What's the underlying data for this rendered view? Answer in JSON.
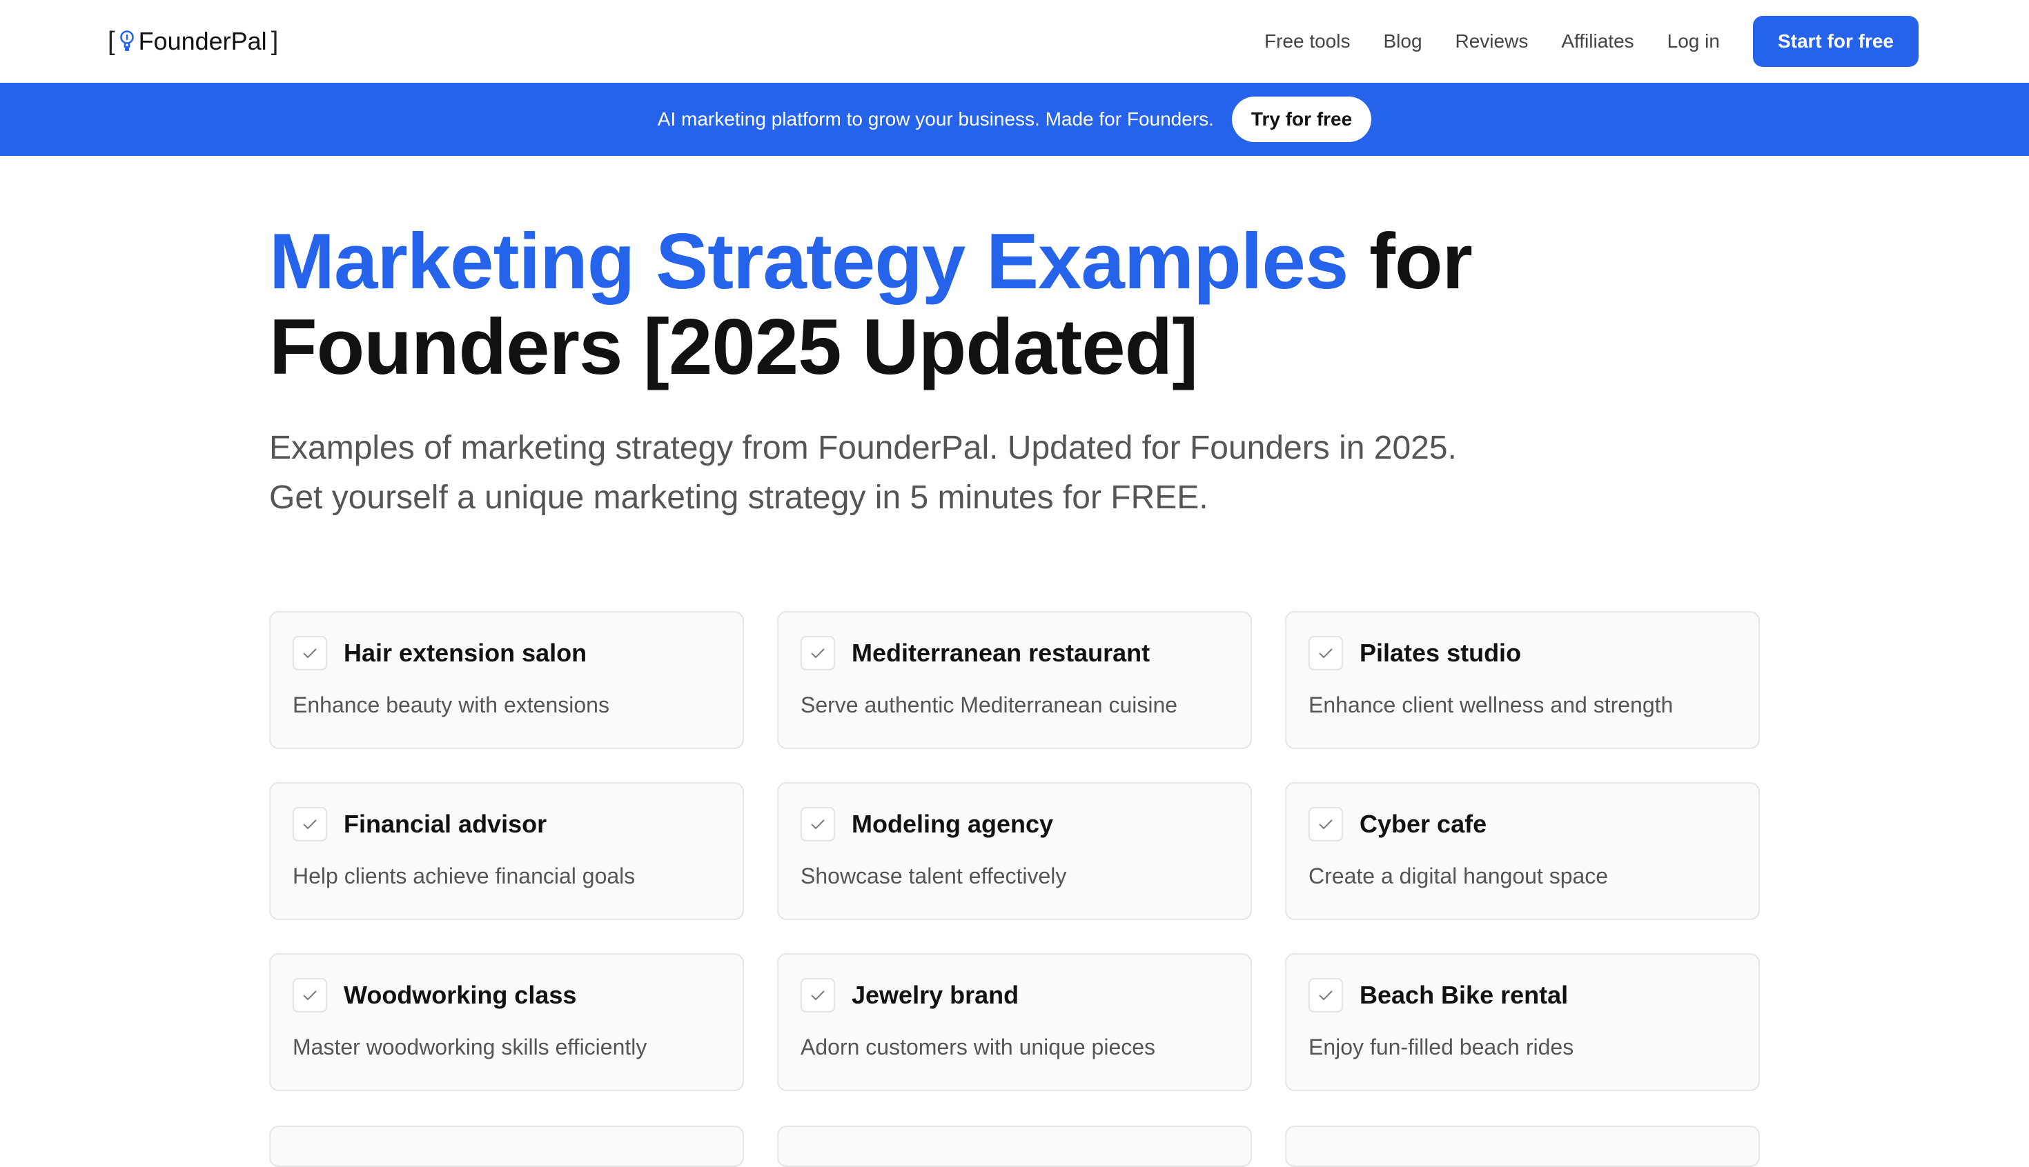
{
  "header": {
    "logo_left_bracket": "[",
    "logo_name": "FounderPal",
    "logo_right_bracket": "]",
    "nav": [
      {
        "label": "Free tools"
      },
      {
        "label": "Blog"
      },
      {
        "label": "Reviews"
      },
      {
        "label": "Affiliates"
      },
      {
        "label": "Log in"
      }
    ],
    "cta_label": "Start for free"
  },
  "banner": {
    "text": "AI marketing platform to grow your business. Made for Founders.",
    "button_label": "Try for free"
  },
  "hero": {
    "title_highlight": "Marketing Strategy Examples",
    "title_rest": " for Founders [2025 Updated]",
    "subtitle_line1": "Examples of marketing strategy from FounderPal. Updated for Founders in 2025.",
    "subtitle_line2": "Get yourself a unique marketing strategy in 5 minutes for FREE."
  },
  "cards": [
    {
      "title": "Hair extension salon",
      "description": "Enhance beauty with extensions"
    },
    {
      "title": "Mediterranean restaurant",
      "description": "Serve authentic Mediterranean cuisine"
    },
    {
      "title": "Pilates studio",
      "description": "Enhance client wellness and strength"
    },
    {
      "title": "Financial advisor",
      "description": "Help clients achieve financial goals"
    },
    {
      "title": "Modeling agency",
      "description": "Showcase talent effectively"
    },
    {
      "title": "Cyber cafe",
      "description": "Create a digital hangout space"
    },
    {
      "title": "Woodworking class",
      "description": "Master woodworking skills efficiently"
    },
    {
      "title": "Jewelry brand",
      "description": "Adorn customers with unique pieces"
    },
    {
      "title": "Beach Bike rental",
      "description": "Enjoy fun-filled beach rides"
    }
  ],
  "colors": {
    "accent": "#2563eb",
    "text": "#111111",
    "muted": "#555555",
    "card_bg": "#fafafa",
    "card_border": "#e5e5e5"
  },
  "icons": {
    "logo": "lightbulb-icon",
    "card_check": "check-icon"
  }
}
